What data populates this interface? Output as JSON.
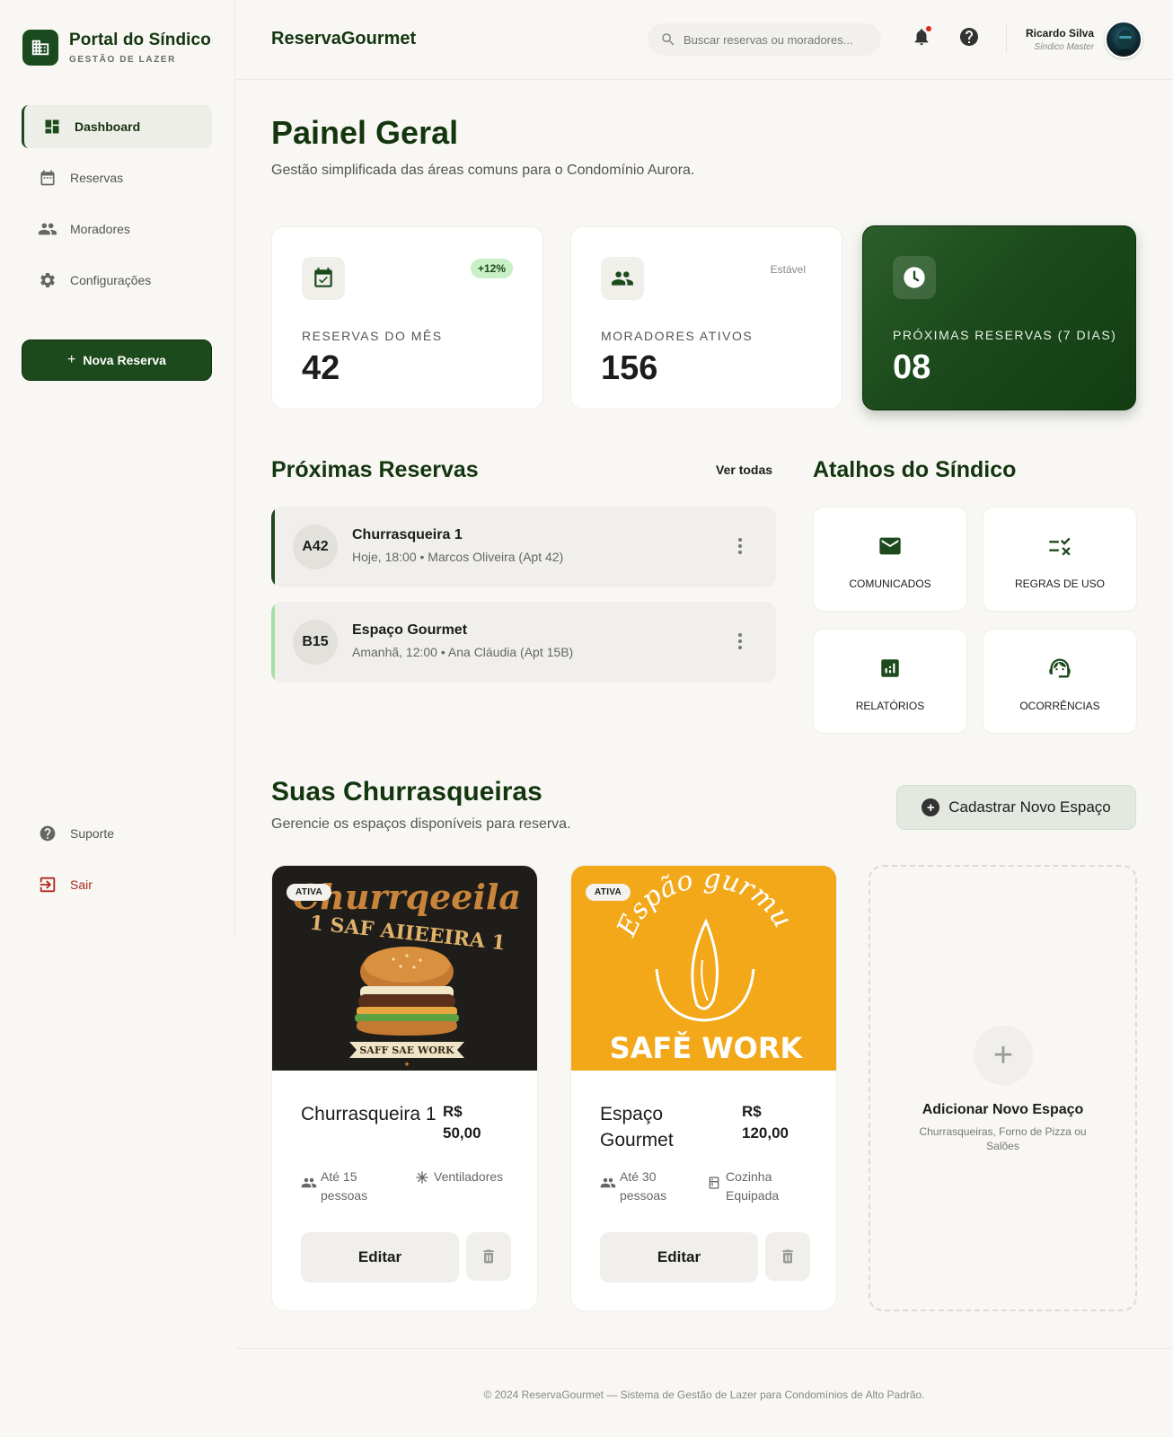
{
  "brand": {
    "title": "Portal do Síndico",
    "subtitle": "GESTÃO DE LAZER"
  },
  "sidebar": {
    "items": [
      {
        "label": "Dashboard",
        "icon": "dashboard-icon",
        "active": true
      },
      {
        "label": "Reservas",
        "icon": "calendar-icon"
      },
      {
        "label": "Moradores",
        "icon": "people-icon"
      },
      {
        "label": "Configurações",
        "icon": "gear-icon"
      }
    ],
    "new_button": "Nova Reserva",
    "support": "Suporte",
    "logout": "Sair"
  },
  "topbar": {
    "app_name": "ReservaGourmet",
    "search_placeholder": "Buscar reservas ou moradores...",
    "user_name": "Ricardo Silva",
    "user_role": "Síndico Master"
  },
  "page": {
    "title": "Painel Geral",
    "subtitle": "Gestão simplificada das áreas comuns para o Condomínio Aurora."
  },
  "stats": [
    {
      "label": "RESERVAS DO MÊS",
      "value": "42",
      "badge": "+12%"
    },
    {
      "label": "MORADORES ATIVOS",
      "value": "156",
      "badge": "Estável"
    },
    {
      "label": "PRÓXIMAS RESERVAS (7 DIAS)",
      "value": "08"
    }
  ],
  "upcoming": {
    "title": "Próximas Reservas",
    "see_all": "Ver todas",
    "items": [
      {
        "code": "A42",
        "title": "Churrasqueira 1",
        "when": "Hoje, 18:00",
        "who": "Marcos Oliveira (Apt 42)",
        "accent": "#1c4a1c"
      },
      {
        "code": "B15",
        "title": "Espaço Gourmet",
        "when": "Amanhã, 12:00",
        "who": "Ana Cláudia (Apt 15B)",
        "accent": "#a9dea2"
      }
    ]
  },
  "shortcuts": {
    "title": "Atalhos do Síndico",
    "items": [
      {
        "label": "COMUNICADOS",
        "icon": "mail-icon"
      },
      {
        "label": "REGRAS DE USO",
        "icon": "rules-icon"
      },
      {
        "label": "RELATÓRIOS",
        "icon": "chart-icon"
      },
      {
        "label": "OCORRÊNCIAS",
        "icon": "support-agent-icon"
      }
    ]
  },
  "spaces": {
    "title": "Suas Churrasqueiras",
    "subtitle": "Gerencie os espaços disponíveis para reserva.",
    "register_button": "Cadastrar Novo Espaço",
    "items": [
      {
        "status": "ATIVA",
        "name": "Churrasqueira 1",
        "price_currency": "R$",
        "price_value": "50,00",
        "capacity": "Até 15 pessoas",
        "feature": "Ventiladores",
        "feature_icon": "fan-icon",
        "edit": "Editar",
        "image": {
          "top_text": "Churrqeeila",
          "mid_text": "1 SAF AIIEEIRA 1",
          "banner_text": "SAFF SAE WORK"
        }
      },
      {
        "status": "ATIVA",
        "name": "Espaço Gourmet",
        "price_currency": "R$",
        "price_value": "120,00",
        "capacity": "Até 30 pessoas",
        "feature": "Cozinha Equipada",
        "feature_icon": "kitchen-icon",
        "edit": "Editar",
        "image": {
          "top_text": "Espão gurmu",
          "bottom_text": "SAFĚ WORK"
        }
      }
    ],
    "add": {
      "title": "Adicionar Novo Espaço",
      "subtitle": "Churrasqueiras, Forno de Pizza ou Salões"
    }
  },
  "footer": "© 2024 ReservaGourmet — Sistema de Gestão de Lazer para Condomínios de Alto Padrão.",
  "colors": {
    "primary": "#1c4a1c",
    "accent_light": "#a9dea2",
    "danger": "#b0281d",
    "background": "#f8f7f4"
  }
}
